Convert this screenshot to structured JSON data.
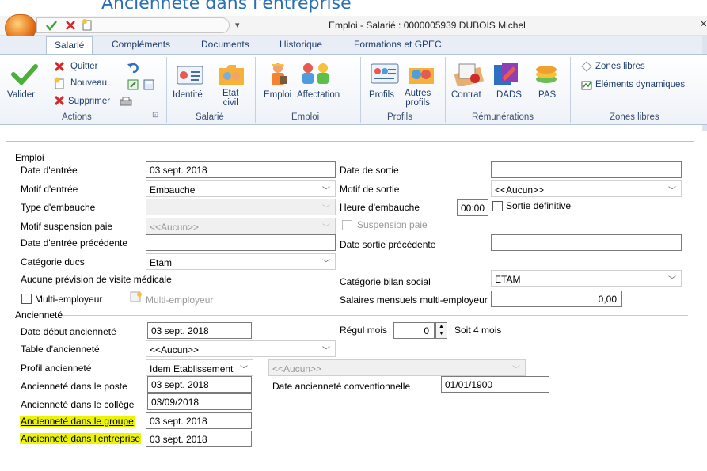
{
  "caption": "Ancienneté dans l'entreprise",
  "window": {
    "title": "Emploi - Salarié : 0000005939 DUBOIS Michel",
    "close": "×",
    "qa_dropdown": "▾"
  },
  "ribbon": {
    "tabs": [
      "Salarié",
      "Compléments",
      "Documents",
      "Historique",
      "Formations et GPEC"
    ],
    "actions": {
      "valider": "Valider",
      "quitter": "Quitter",
      "nouveau": "Nouveau",
      "supprimer": "Supprimer",
      "group": "Actions",
      "launcher": "⊡"
    },
    "salarie": {
      "identite": "Identité",
      "etat_civil_1": "Etat",
      "etat_civil_2": "civil",
      "group": "Salarié"
    },
    "emploi": {
      "emploi": "Emploi",
      "affectation": "Affectation",
      "group": "Emploi"
    },
    "profils": {
      "profils": "Profils",
      "autres_1": "Autres",
      "autres_2": "profils",
      "group": "Profils"
    },
    "remunerations": {
      "contrat": "Contrat",
      "dads": "DADS",
      "pas": "PAS",
      "group": "Rémunérations"
    },
    "zones": {
      "zones_libres": "Zones libres",
      "elements": "Eléments dynamiques",
      "group": "Zones libres"
    }
  },
  "emploi_section": {
    "title": "Emploi",
    "date_entree": {
      "label": "Date d'entrée",
      "value": "03 sept. 2018"
    },
    "date_sortie": {
      "label": "Date de sortie",
      "value": ""
    },
    "motif_entree": {
      "label": "Motif d'entrée",
      "value": "Embauche"
    },
    "motif_sortie": {
      "label": "Motif de sortie",
      "value": "<<Aucun>>"
    },
    "type_embauche": {
      "label": "Type d'embauche",
      "value": ""
    },
    "heure_embauche": {
      "label": "Heure d'embauche",
      "value": "00:00"
    },
    "sortie_definitive": {
      "label": "Sortie définitive",
      "checked": false
    },
    "motif_suspension": {
      "label": "Motif suspension paie",
      "value": "<<Aucun>>"
    },
    "suspension_paie": {
      "label": "Suspension paie",
      "checked": false
    },
    "date_entree_prec": {
      "label": "Date d'entrée précédente",
      "value": ""
    },
    "date_sortie_prec": {
      "label": "Date sortie précédente",
      "value": ""
    },
    "categorie_ducs": {
      "label": "Catégorie ducs",
      "value": "Etam"
    },
    "visite_medicale": {
      "label": "Aucune prévision de visite médicale"
    },
    "categorie_bilan": {
      "label": "Catégorie bilan social",
      "value": "ETAM"
    },
    "multi_employeur": {
      "label": "Multi-employeur",
      "checked": false
    },
    "multi_employeur_btn": {
      "label": "Multi-employeur"
    },
    "salaires_multi": {
      "label": "Salaires mensuels multi-employeur",
      "value": "0,00"
    }
  },
  "anciennete_section": {
    "title": "Ancienneté",
    "date_debut": {
      "label": "Date début ancienneté",
      "value": "03 sept. 2018"
    },
    "regul_mois": {
      "label": "Régul mois",
      "value": "0",
      "suffix": "Soit 4 mois"
    },
    "table_anciennete": {
      "label": "Table d'ancienneté",
      "value": "<<Aucun>>"
    },
    "profil_anciennete": {
      "label": "Profil ancienneté",
      "value": "Idem Etablissement",
      "value2": "<<Aucun>>"
    },
    "dans_poste": {
      "label": "Ancienneté dans le poste",
      "value": "03 sept. 2018"
    },
    "date_conventionnelle": {
      "label": "Date ancienneté conventionnelle",
      "value": "01/01/1900"
    },
    "dans_college": {
      "label": "Ancienneté dans le collège",
      "value": "03/09/2018"
    },
    "dans_groupe": {
      "label": "Ancienneté dans le groupe",
      "value": "03 sept. 2018"
    },
    "dans_entreprise": {
      "label": "Ancienneté dans l'entreprise",
      "value": "03 sept. 2018"
    }
  },
  "colors": {
    "highlight": "#ecf400",
    "ribbon_text": "#1f3d6e",
    "caption": "#2a6fb5"
  }
}
